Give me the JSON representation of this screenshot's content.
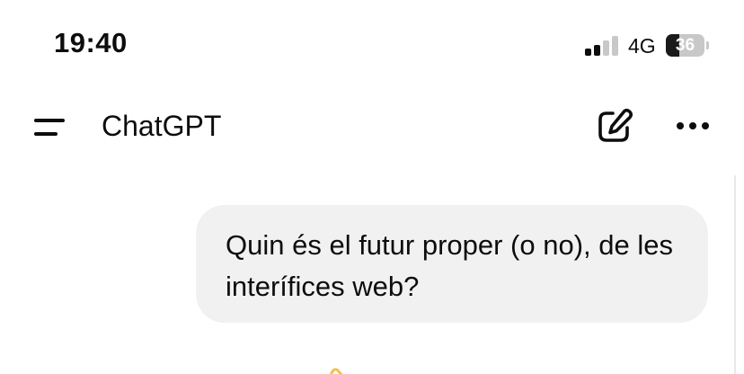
{
  "status_bar": {
    "time": "19:40",
    "network": "4G",
    "battery_percent": "36",
    "battery_level": 0.36,
    "signal_bars_active": 2,
    "signal_bars_total": 4
  },
  "header": {
    "title": "ChatGPT",
    "menu_icon": "menu-icon",
    "new_chat_icon": "edit-icon",
    "more_icon": "more-horizontal-icon"
  },
  "conversation": {
    "messages": [
      {
        "role": "user",
        "text": "Quin és el futur proper (o no), de les interífices web?"
      }
    ]
  },
  "colors": {
    "background": "#ffffff",
    "text": "#0d0d0d",
    "user_bubble": "#f1f1f1",
    "signal_active": "#0d0d0d",
    "signal_inactive": "#c8c8c8",
    "assistant_accent": "#f2c14e"
  }
}
